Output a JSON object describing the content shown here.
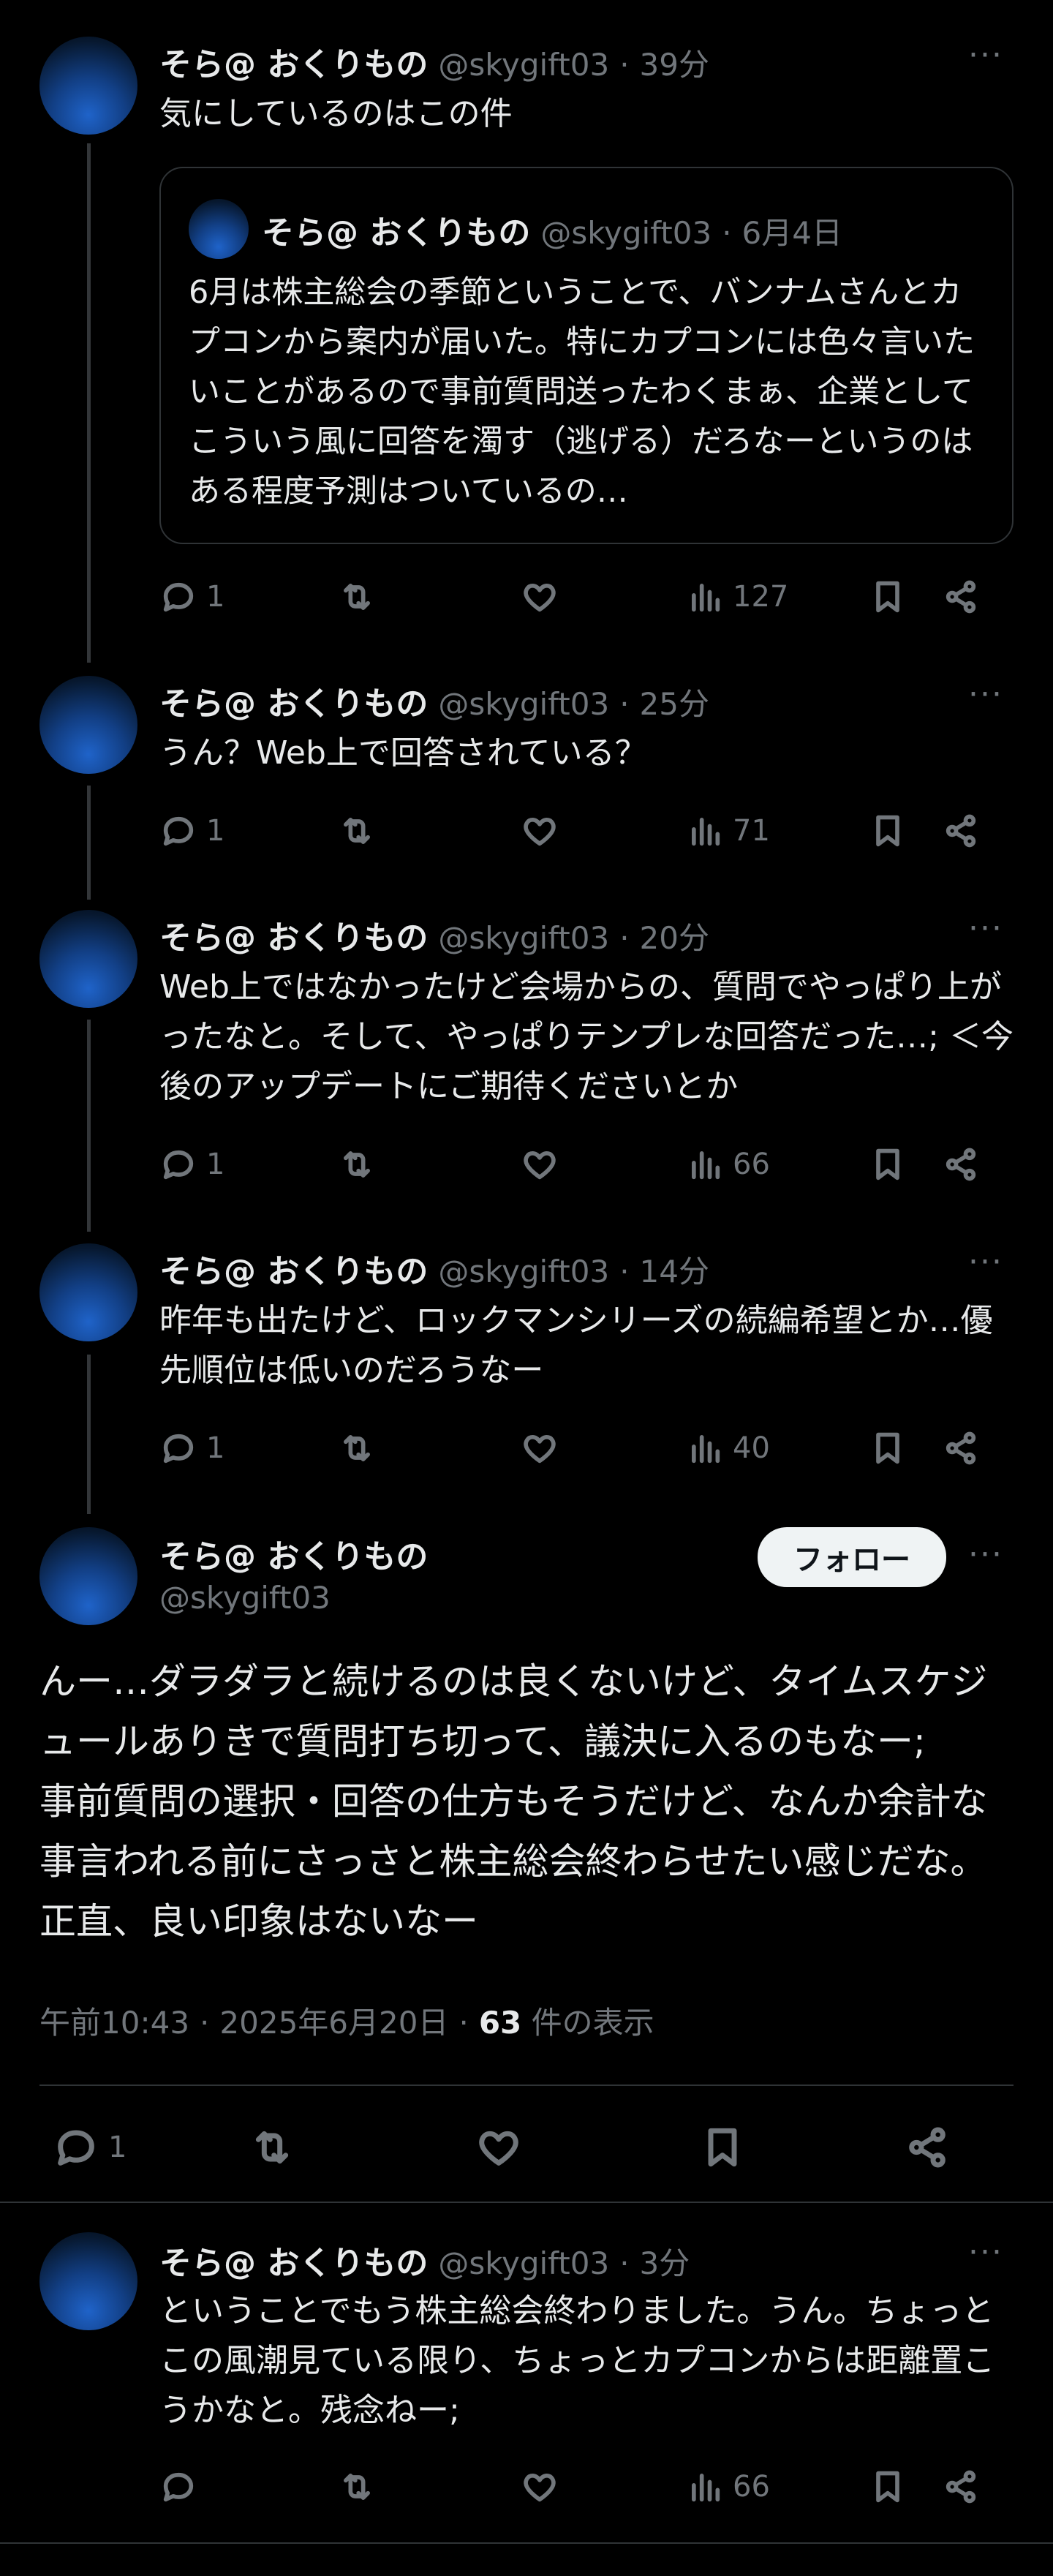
{
  "tweets": [
    {
      "name": "そら@ おくりもの",
      "handle": "@skygift03",
      "time": "39分",
      "text": "気にしているのはこの件",
      "quote": {
        "name": "そら@ おくりもの",
        "handle": "@skygift03",
        "date": "6月4日",
        "text": "6月は株主総会の季節ということで、バンナムさんとカプコンから案内が届いた。特にカプコンには色々言いたいことがあるので事前質問送ったわくまぁ、企業としてこういう風に回答を濁す（逃げる）だろなーというのはある程度予測はついているの…"
      },
      "replies": "1",
      "views": "127"
    },
    {
      "name": "そら@ おくりもの",
      "handle": "@skygift03",
      "time": "25分",
      "text": "うん？Web上で回答されている？",
      "replies": "1",
      "views": "71"
    },
    {
      "name": "そら@ おくりもの",
      "handle": "@skygift03",
      "time": "20分",
      "text": "Web上ではなかったけど会場からの、質問でやっぱり上がったなと。そして、やっぱりテンプレな回答だった…; ＜今後のアップデートにご期待くださいとか",
      "replies": "1",
      "views": "66"
    },
    {
      "name": "そら@ おくりもの",
      "handle": "@skygift03",
      "time": "14分",
      "text": "昨年も出たけど、ロックマンシリーズの続編希望とか…優先順位は低いのだろうなー",
      "replies": "1",
      "views": "40"
    }
  ],
  "main": {
    "name": "そら@ おくりもの",
    "handle": "@skygift03",
    "follow_label": "フォロー",
    "text": "んー…ダラダラと続けるのは良くないけど、タイムスケジュールありきで質問打ち切って、議決に入るのもなー;　事前質問の選択・回答の仕方もそうだけど、なんか余計な事言われる前にさっさと株主総会終わらせたい感じだな。正直、良い印象はないなー",
    "time": "午前10:43",
    "date": "2025年6月20日",
    "views_count": "63",
    "views_label": "件の表示",
    "replies": "1"
  },
  "reply": {
    "name": "そら@ おくりもの",
    "handle": "@skygift03",
    "time": "3分",
    "text": "ということでもう株主総会終わりました。うん。ちょっとこの風潮見ている限り、ちょっとカプコンからは距離置こうかなと。残念ねー;",
    "views": "66"
  },
  "separator": "·",
  "more_glyph": "···",
  "icons": [
    "reply-icon",
    "retweet-icon",
    "like-icon",
    "views-icon",
    "bookmark-icon",
    "share-icon",
    "more-icon"
  ]
}
